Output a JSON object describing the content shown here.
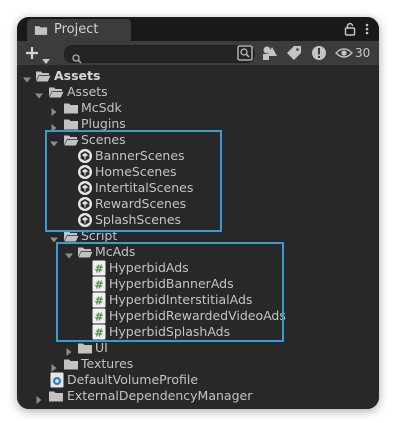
{
  "window": {
    "tab_title": "Project",
    "search": {
      "placeholder": "",
      "value": ""
    },
    "visibility_count": "30",
    "icons": {
      "tab": "folder-icon",
      "lock": "lock-icon",
      "menu": "kebab-menu-icon",
      "create": "plus-icon",
      "create_dropdown": "chevron-down-icon",
      "search": "search-icon",
      "search_by_type": "search-by-type-icon",
      "filter_by_type": "filter-by-type-icon",
      "filter_by_label": "tag-icon",
      "errors": "error-icon",
      "visibility": "eye-icon"
    }
  },
  "colors": {
    "window_bg": "#282828",
    "toolbar_bg": "#3c3c3c",
    "highlight_border": "#3a9ad6",
    "text": "#c4c4c4"
  },
  "tree": {
    "assets_root": "Assets",
    "assets": "Assets",
    "mcsdk": "McSdk",
    "plugins": "Plugins",
    "scenes": "Scenes",
    "scene_items": [
      "BannerScenes",
      "HomeScenes",
      "IntertitalScenes",
      "RewardScenes",
      "SplashScenes"
    ],
    "script": "Script",
    "mcads": "McAds",
    "script_items": [
      "HyperbidAds",
      "HyperbidBannerAds",
      "HyperbidInterstitialAds",
      "HyperbidRewardedVideoAds",
      "HyperbidSplashAds"
    ],
    "ui": "UI",
    "textures": "Textures",
    "default_volume_profile": "DefaultVolumeProfile",
    "external_dependency_manager": "ExternalDependencyManager"
  }
}
